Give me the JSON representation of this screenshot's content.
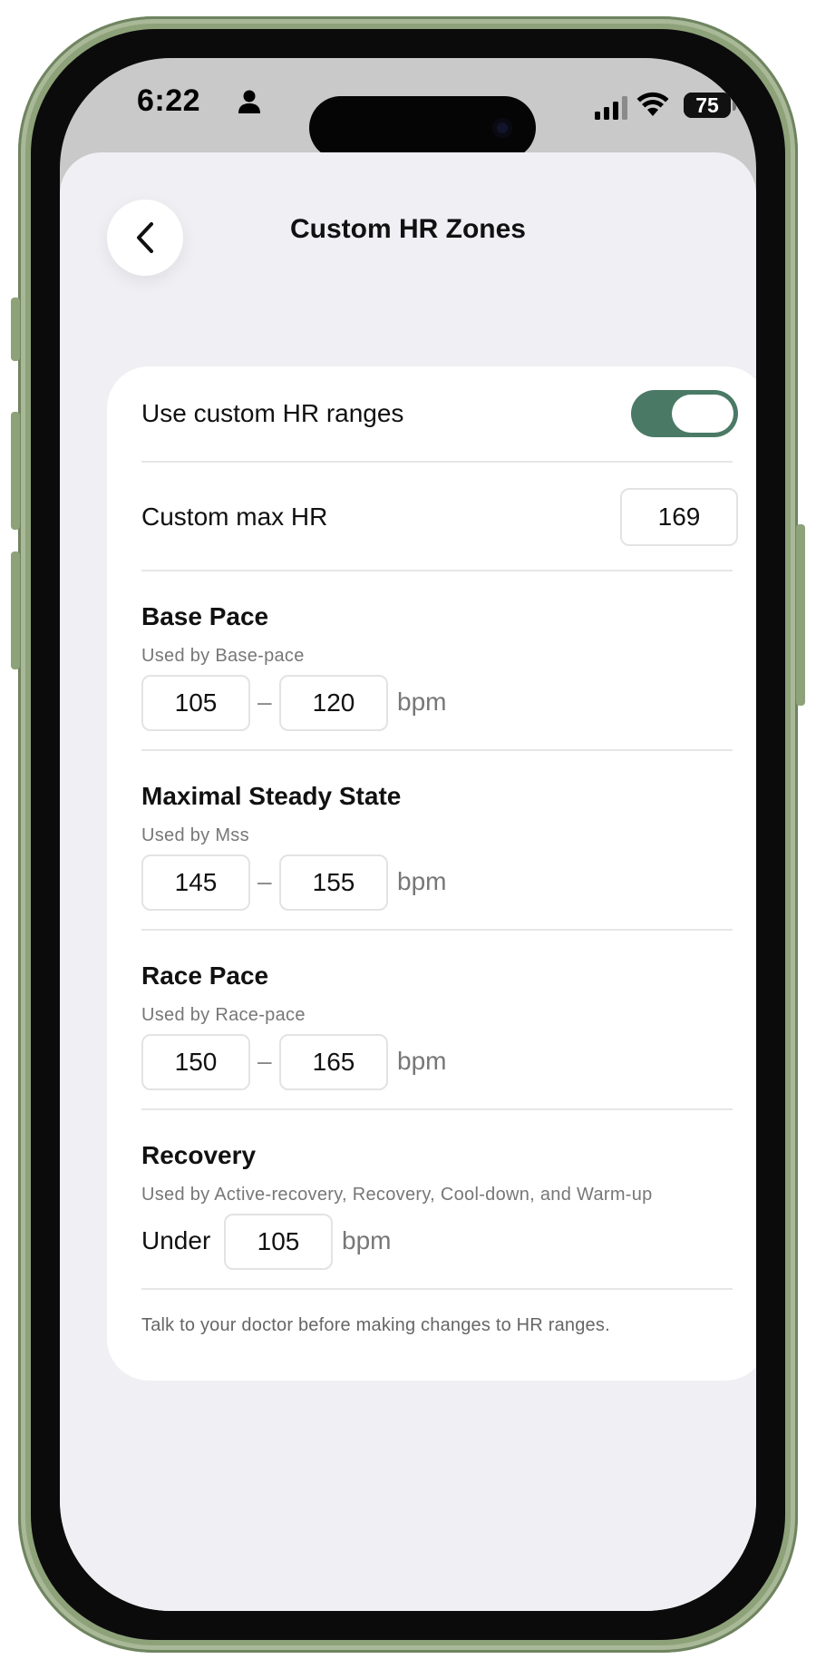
{
  "status_bar": {
    "time": "6:22",
    "battery": "75"
  },
  "header": {
    "title": "Custom HR Zones"
  },
  "settings": {
    "toggle_label": "Use custom HR ranges",
    "toggle_on": true,
    "max_hr_label": "Custom max HR",
    "max_hr_value": "169"
  },
  "zones": [
    {
      "title": "Base Pace",
      "subtitle": "Used by Base-pace",
      "low": "105",
      "high": "120",
      "separator": "–",
      "unit": "bpm"
    },
    {
      "title": "Maximal Steady State",
      "subtitle": "Used by Mss",
      "low": "145",
      "high": "155",
      "separator": "–",
      "unit": "bpm"
    },
    {
      "title": "Race Pace",
      "subtitle": "Used by Race-pace",
      "low": "150",
      "high": "165",
      "separator": "–",
      "unit": "bpm"
    }
  ],
  "recovery": {
    "title": "Recovery",
    "subtitle": "Used by Active-recovery, Recovery, Cool-down, and Warm-up",
    "prefix": "Under",
    "value": "105",
    "unit": "bpm"
  },
  "footnote": "Talk to your doctor before making changes to HR ranges.",
  "colors": {
    "accent": "#4a7a66",
    "background": "#efeff4",
    "frame": "#8ea27a"
  }
}
